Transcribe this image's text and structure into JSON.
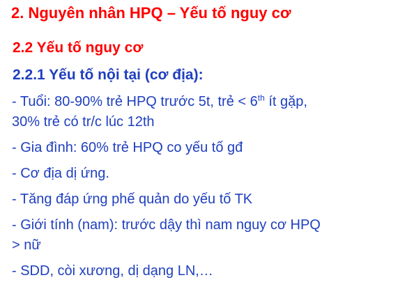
{
  "title": "2. Nguyên nhân HPQ – Yếu tố nguy cơ",
  "section": "2.2 Yếu tố nguy cơ",
  "subsection": "2.2.1 Yếu tố nội tại (cơ địa):",
  "bullets": {
    "age": {
      "part1": "- Tuổi: 80-90% trẻ HPQ trước 5t, trẻ < 6",
      "sup": "th",
      "part2": " ít gặp,",
      "line2": "30% trẻ có tr/c lúc 12th"
    },
    "family": "- Gia đình: 60% trẻ HPQ co yếu tố gđ",
    "atopy": "- Cơ địa dị ứng.",
    "hyperresponsive": "- Tăng đáp ứng phế quản do yếu tố TK",
    "sex": {
      "line1": "- Giới tính (nam): trước dậy thì nam nguy cơ HPQ",
      "line2": "> nữ"
    },
    "malnutrition": "- SDD, còi xương, dị dạng LN,…"
  }
}
